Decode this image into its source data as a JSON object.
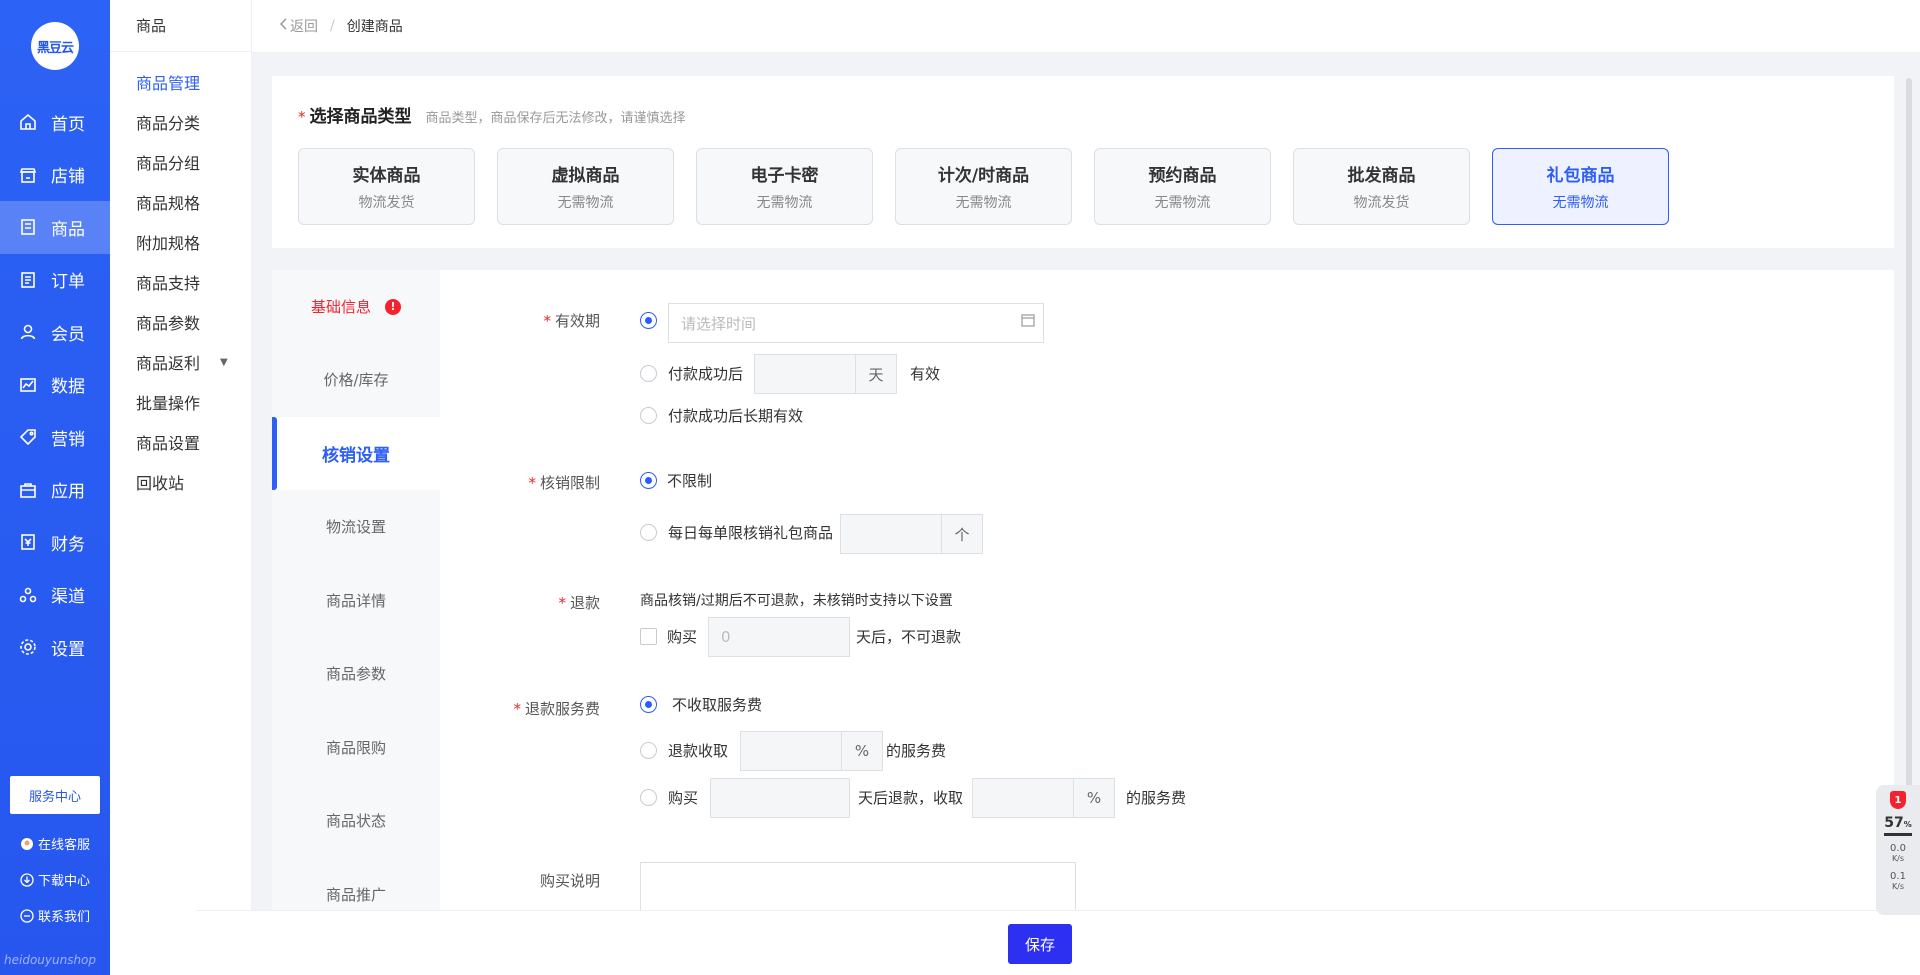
{
  "brand": {
    "logo_text": "黑豆云",
    "footer_text": "heidouyunshop"
  },
  "primary_nav": [
    {
      "label": "首页",
      "icon": "home-icon"
    },
    {
      "label": "店铺",
      "icon": "store-icon"
    },
    {
      "label": "商品",
      "icon": "goods-icon",
      "active": true
    },
    {
      "label": "订单",
      "icon": "order-icon"
    },
    {
      "label": "会员",
      "icon": "user-icon"
    },
    {
      "label": "数据",
      "icon": "chart-icon"
    },
    {
      "label": "营销",
      "icon": "tag-icon"
    },
    {
      "label": "应用",
      "icon": "app-icon"
    },
    {
      "label": "财务",
      "icon": "finance-icon"
    },
    {
      "label": "渠道",
      "icon": "channel-icon"
    },
    {
      "label": "设置",
      "icon": "gear-icon"
    }
  ],
  "service_center": "服务中心",
  "aux_links": {
    "online_service": "在线客服",
    "download_center": "下载中心",
    "contact_us": "联系我们"
  },
  "secondary_nav": {
    "header": "商品",
    "items": [
      "商品管理",
      "商品分类",
      "商品分组",
      "商品规格",
      "附加规格",
      "商品支持",
      "商品参数",
      "商品返利",
      "批量操作",
      "商品设置",
      "回收站"
    ]
  },
  "breadcrumb": {
    "back": "返回",
    "separator": "/",
    "current": "创建商品"
  },
  "type_section": {
    "required_mark": "*",
    "title": "选择商品类型",
    "hint": "商品类型，商品保存后无法修改，请谨慎选择",
    "types": [
      {
        "name": "实体商品",
        "desc": "物流发货"
      },
      {
        "name": "虚拟商品",
        "desc": "无需物流"
      },
      {
        "name": "电子卡密",
        "desc": "无需物流"
      },
      {
        "name": "计次/时商品",
        "desc": "无需物流"
      },
      {
        "name": "预约商品",
        "desc": "无需物流"
      },
      {
        "name": "批发商品",
        "desc": "物流发货"
      },
      {
        "name": "礼包商品",
        "desc": "无需物流",
        "selected": true
      }
    ]
  },
  "tabs": [
    "基础信息",
    "价格/库存",
    "核销设置",
    "物流设置",
    "商品详情",
    "商品参数",
    "商品限购",
    "商品状态",
    "商品推广"
  ],
  "tab_error_badge": "!",
  "form": {
    "validity": {
      "label": "有效期",
      "time_placeholder": "请选择时间",
      "after_pay_prefix": "付款成功后",
      "after_pay_unit": "天",
      "after_pay_suffix": "有效",
      "long_term": "付款成功后长期有效"
    },
    "verify_limit": {
      "label": "核销限制",
      "unlimited": "不限制",
      "daily_limit": "每日每单限核销礼包商品",
      "daily_unit": "个"
    },
    "refund": {
      "label": "退款",
      "note": "商品核销/过期后不可退款，未核销时支持以下设置",
      "buy": "购买",
      "days_value": "0",
      "days_suffix": "天后，不可退款"
    },
    "refund_fee": {
      "label": "退款服务费",
      "no_fee": "不收取服务费",
      "refund_charge": "退款收取",
      "percent": "%",
      "fee_suffix": "的服务费",
      "buy": "购买",
      "days_then": "天后退款，收取"
    },
    "purchase_note": {
      "label": "购买说明"
    }
  },
  "save_button": "保存",
  "widget": {
    "badge": "1",
    "percent": "57",
    "percent_unit": "%",
    "up": "0.0",
    "down": "0.1",
    "unit": "K/s"
  }
}
